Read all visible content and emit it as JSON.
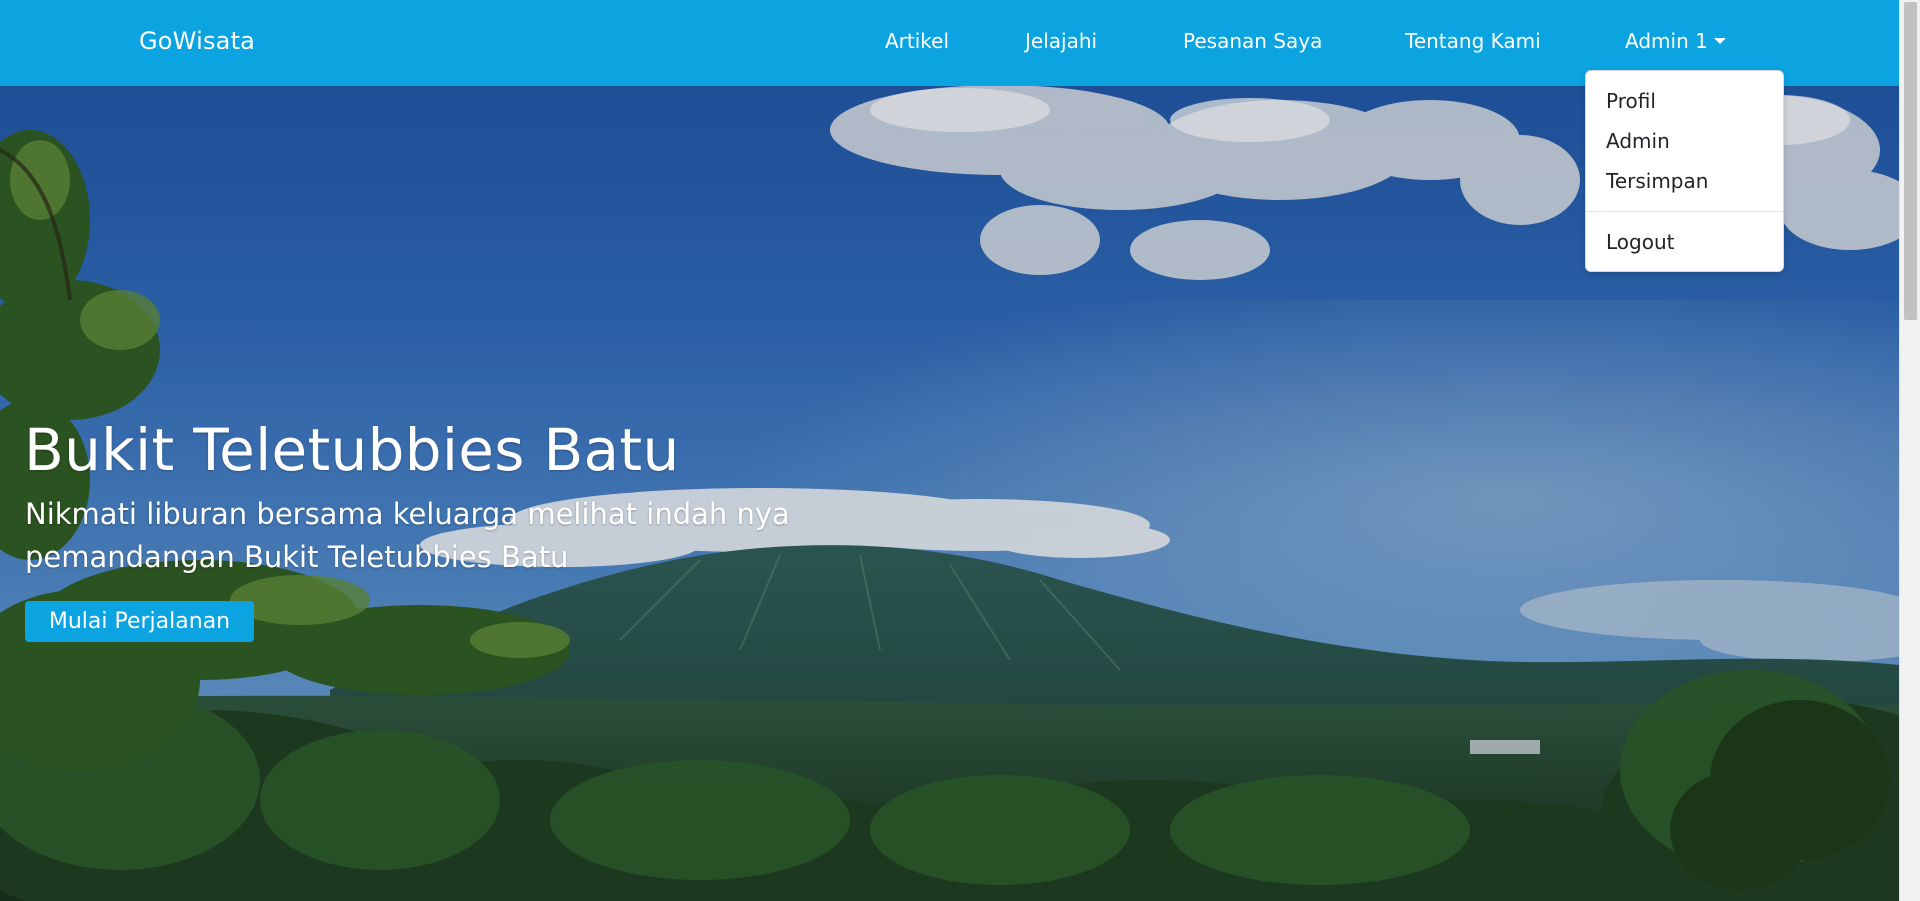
{
  "navbar": {
    "brand": "GoWisata",
    "items": [
      {
        "label": "Artikel"
      },
      {
        "label": "Jelajahi"
      },
      {
        "label": "Pesanan Saya"
      },
      {
        "label": "Tentang Kami"
      }
    ],
    "user_menu_label": "Admin 1",
    "background_color": "#0ba3e0"
  },
  "dropdown": {
    "items": [
      {
        "label": "Profil"
      },
      {
        "label": "Admin"
      },
      {
        "label": "Tersimpan"
      }
    ],
    "logout_label": "Logout"
  },
  "hero": {
    "title": "Bukit Teletubbies Batu",
    "subtitle": "Nikmati liburan bersama keluarga melihat indah nya pemandangan Bukit Teletubbies Batu",
    "cta_label": "Mulai Perjalanan",
    "background_image": "mountain-landscape-photo"
  },
  "colors": {
    "accent": "#0ba3e0",
    "text_light": "#ffffff",
    "text_dark": "#212529"
  }
}
